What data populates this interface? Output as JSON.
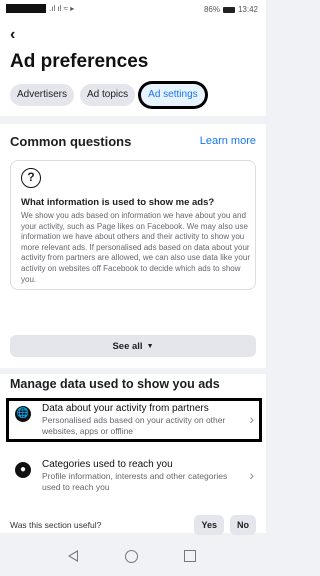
{
  "status_bar": {
    "signal_text": "📶 📶 ➤",
    "battery_text": "86%",
    "time": "13:42"
  },
  "header": {
    "back_icon": "chevron-left-icon",
    "title": "Ad preferences",
    "tabs": [
      {
        "label": "Advertisers"
      },
      {
        "label": "Ad topics"
      },
      {
        "label": "Ad settings",
        "active": true
      }
    ]
  },
  "common_questions": {
    "title": "Common questions",
    "learn_more": "Learn more",
    "faq": {
      "icon": "question-circle-icon",
      "question": "What information is used to show me ads?",
      "answer": "We show you ads based on information we have about you and your activity, such as Page likes on Facebook. We may also use information we have about others and their activity to show you more relevant ads. If personalised ads based on data about your activity from partners are allowed, we can also use data like your activity on websites off Facebook to decide which ads to show you."
    },
    "see_all": "See all"
  },
  "manage_data": {
    "title": "Manage data used to show you ads",
    "items": [
      {
        "icon": "globe-icon",
        "title": "Data about your activity from partners",
        "subtitle": "Personalised ads based on your activity on other websites, apps or offline"
      },
      {
        "icon": "person-icon",
        "title": "Categories used to reach you",
        "subtitle": "Profile information, interests and other categories used to reach you"
      }
    ]
  },
  "feedback": {
    "question": "Was this section useful?",
    "yes": "Yes",
    "no": "No"
  },
  "colors": {
    "accent": "#1877f2",
    "background": "#f0f2f5",
    "chip": "#e4e6eb"
  }
}
